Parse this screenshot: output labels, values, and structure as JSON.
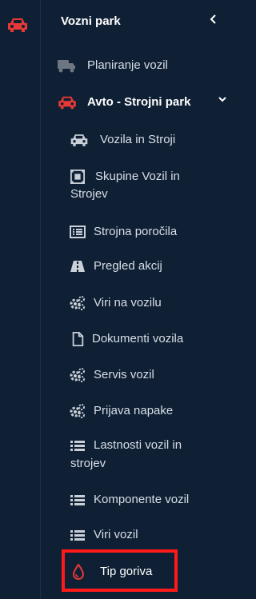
{
  "header": {
    "title": "Vozni park",
    "collapse_icon": "chevron-left-icon"
  },
  "rail": {
    "active_icon": "car-icon",
    "accent": "#e53935"
  },
  "menu": {
    "planiranje": {
      "label": "Planiranje vozil",
      "icon": "truck-icon"
    },
    "avto": {
      "label": "Avto - Strojni park",
      "icon": "car-icon",
      "expanded": true
    },
    "children": [
      {
        "label": "Vozila in Stroji",
        "icon": "car-icon"
      },
      {
        "label_line1": "Skupine Vozil in",
        "label_line2": "Strojev",
        "icon": "object-group-icon"
      },
      {
        "label": "Strojna poročila",
        "icon": "list-alt-icon"
      },
      {
        "label": "Pregled akcij",
        "icon": "road-icon"
      },
      {
        "label": "Viri na vozilu",
        "icon": "cogs-icon"
      },
      {
        "label": "Dokumenti vozila",
        "icon": "file-icon"
      },
      {
        "label": "Servis vozil",
        "icon": "cogs-icon"
      },
      {
        "label": "Prijava napake",
        "icon": "cogs-icon"
      },
      {
        "label_line1": "Lastnosti vozil in",
        "label_line2": "strojev",
        "icon": "list-icon"
      },
      {
        "label": "Komponente vozil",
        "icon": "list-icon"
      },
      {
        "label": "Viri vozil",
        "icon": "list-icon"
      },
      {
        "label": "Tip goriva",
        "icon": "tint-icon",
        "highlighted": true
      }
    ]
  },
  "colors": {
    "background": "#0f2035",
    "text": "#d8dee6",
    "accent_red": "#e53935",
    "icon_gray": "#c9d0d8",
    "highlight_border": "#ff1a1a"
  }
}
